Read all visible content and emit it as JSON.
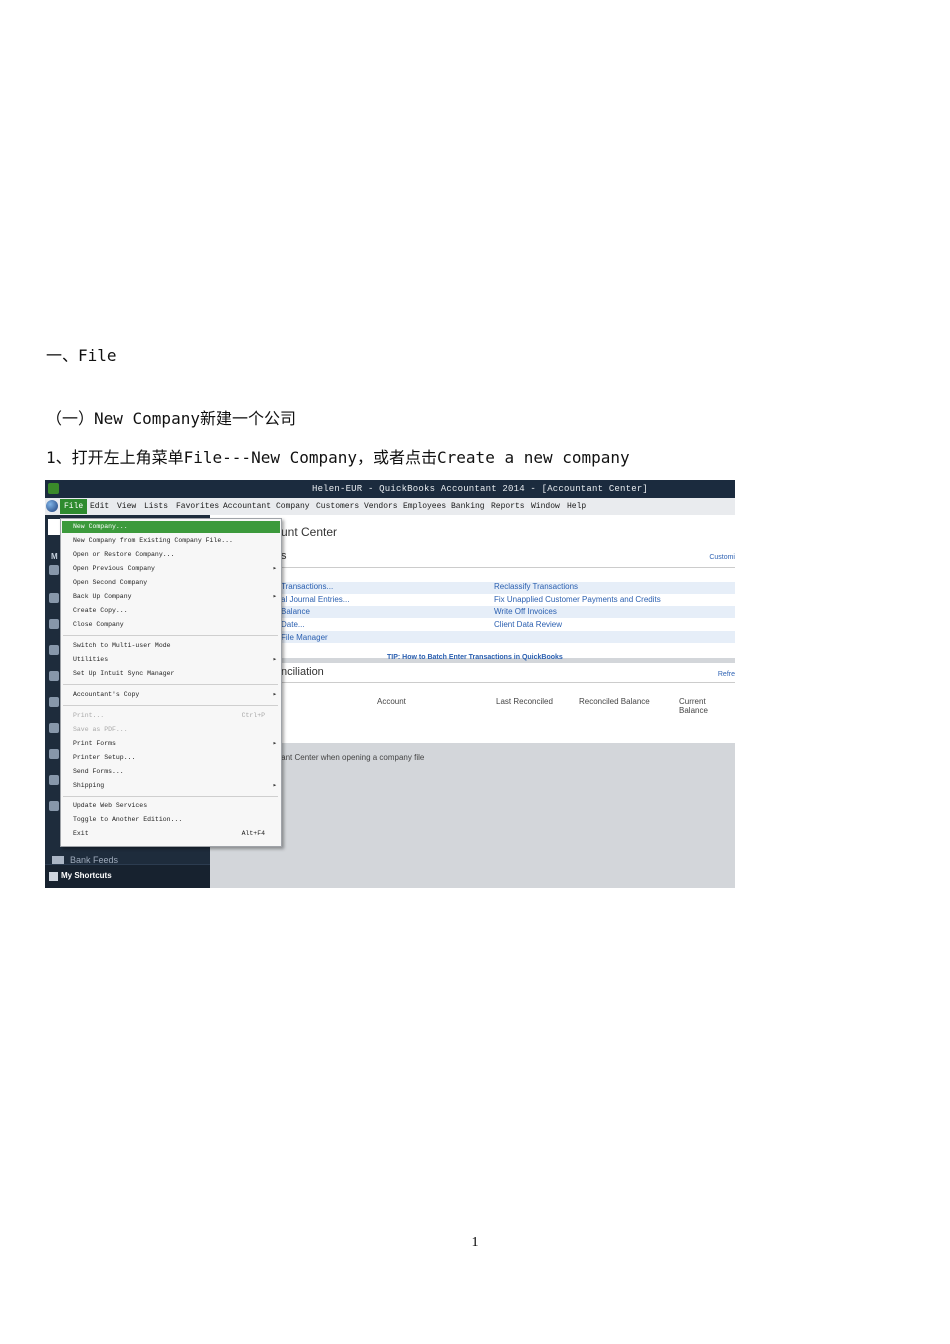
{
  "doc": {
    "heading": "一、File",
    "subheading": "（一）New Company新建一个公司",
    "step1": "1、打开左上角菜单File---New Company，或者点击Create a new company",
    "page_number": "1"
  },
  "qb": {
    "window_title": "Helen-EUR  - QuickBooks Accountant 2014 - [Accountant Center]",
    "menus": [
      "File",
      "Edit",
      "View",
      "Lists",
      "Favorites",
      "Accountant",
      "Company",
      "Customers",
      "Vendors",
      "Employees",
      "Banking",
      "Reports",
      "Window",
      "Help"
    ],
    "sidebar": {
      "letter": "M",
      "bank_feeds": "Bank Feeds",
      "shortcuts": "My Shortcuts"
    },
    "main": {
      "title": "unt Center",
      "tools_header": "s",
      "customize": "Customi",
      "links_left": [
        "Transactions...",
        "al Journal Entries...",
        " Balance",
        "Date...",
        "File Manager"
      ],
      "links_right": [
        "Reclassify Transactions",
        "Fix Unapplied Customer Payments and Credits",
        "Write Off Invoices",
        "Client Data Review"
      ],
      "tip": "TIP: How to Batch Enter Transactions in QuickBooks",
      "recon_header": "nciliation",
      "refresh": "Refre",
      "columns": [
        "Account",
        "Last Reconciled",
        "Reconciled Balance",
        "Current Balance"
      ],
      "footer": "untant Center when opening a company file"
    },
    "file_menu": {
      "items": [
        "New Company...",
        "New Company from Existing Company File...",
        "Open or Restore Company...",
        "Open Previous Company",
        "Open Second Company",
        "Back Up Company",
        "Create Copy...",
        "Close Company",
        "Switch to Multi-user Mode",
        "Utilities",
        "Set Up Intuit Sync Manager",
        "Accountant's Copy",
        "Print...",
        "Save as PDF...",
        "Print Forms",
        "Printer Setup...",
        "Send Forms...",
        "Shipping",
        "Update Web Services",
        "Toggle to Another Edition...",
        "Exit"
      ],
      "print_shortcut": "Ctrl+P",
      "exit_shortcut": "Alt+F4"
    }
  }
}
